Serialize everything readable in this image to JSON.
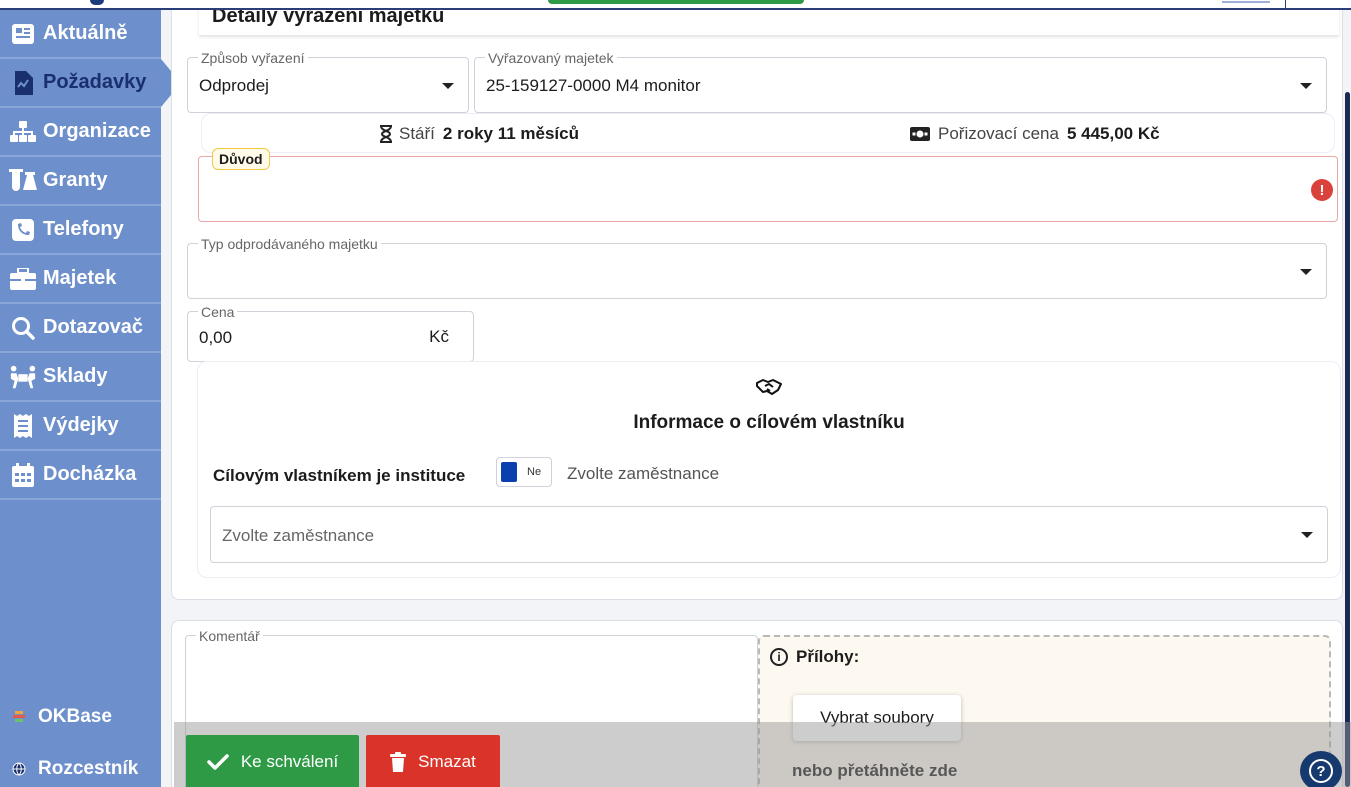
{
  "nav": {
    "items": [
      {
        "label": "Aktuálně",
        "icon": "newspaper-icon"
      },
      {
        "label": "Požadavky",
        "icon": "request-icon",
        "active": true
      },
      {
        "label": "Organizace",
        "icon": "org-chart-icon"
      },
      {
        "label": "Granty",
        "icon": "flask-icon"
      },
      {
        "label": "Telefony",
        "icon": "phone-icon"
      },
      {
        "label": "Majetek",
        "icon": "briefcase-icon"
      },
      {
        "label": "Dotazovač",
        "icon": "search-icon"
      },
      {
        "label": "Sklady",
        "icon": "people-carry-icon"
      },
      {
        "label": "Výdejky",
        "icon": "receipt-icon"
      },
      {
        "label": "Docházka",
        "icon": "calendar-icon"
      }
    ],
    "bottom": [
      {
        "label": "OKBase",
        "icon": "okbase-icon"
      },
      {
        "label": "Rozcestník",
        "icon": "globe-icon"
      }
    ]
  },
  "section": {
    "title": "Detaily vyřazení majetku"
  },
  "form": {
    "disposal_method": {
      "label": "Způsob vyřazení",
      "value": "Odprodej"
    },
    "asset": {
      "label": "Vyřazovaný majetek",
      "value": "25-159127-0000 M4  monitor"
    },
    "age": {
      "label": "Stáří",
      "value": "2 roky 11 měsíců"
    },
    "purchase_price": {
      "label": "Pořizovací cena",
      "value": "5 445,00 Kč"
    },
    "reason": {
      "label": "Důvod",
      "error_mark": "!"
    },
    "sold_type": {
      "label": "Typ odprodávaného majetku",
      "value": ""
    },
    "price": {
      "label": "Cena",
      "value": "0,00",
      "unit": "Kč"
    }
  },
  "owner": {
    "title": "Informace o cílovém vlastníku",
    "institution_label": "Cílovým vlastníkem je instituce",
    "toggle_value": "Ne",
    "toggle_hint": "Zvolte zaměstnance",
    "employee_placeholder": "Zvolte zaměstnance"
  },
  "comment": {
    "label": "Komentář"
  },
  "attachments": {
    "title": "Přílohy:",
    "pick_label": "Vybrat soubory",
    "drop_hint": "nebo přetáhněte zde"
  },
  "actions": {
    "approve": "Ke schválení",
    "delete": "Smazat"
  },
  "help": {
    "label": "?"
  },
  "colors": {
    "sidebar": "#6d8fcb",
    "active_text": "#1a2f6e",
    "approve": "#2f9a45",
    "delete": "#d9332a",
    "error": "#d9413a",
    "toggle_knob": "#0b3fae"
  }
}
